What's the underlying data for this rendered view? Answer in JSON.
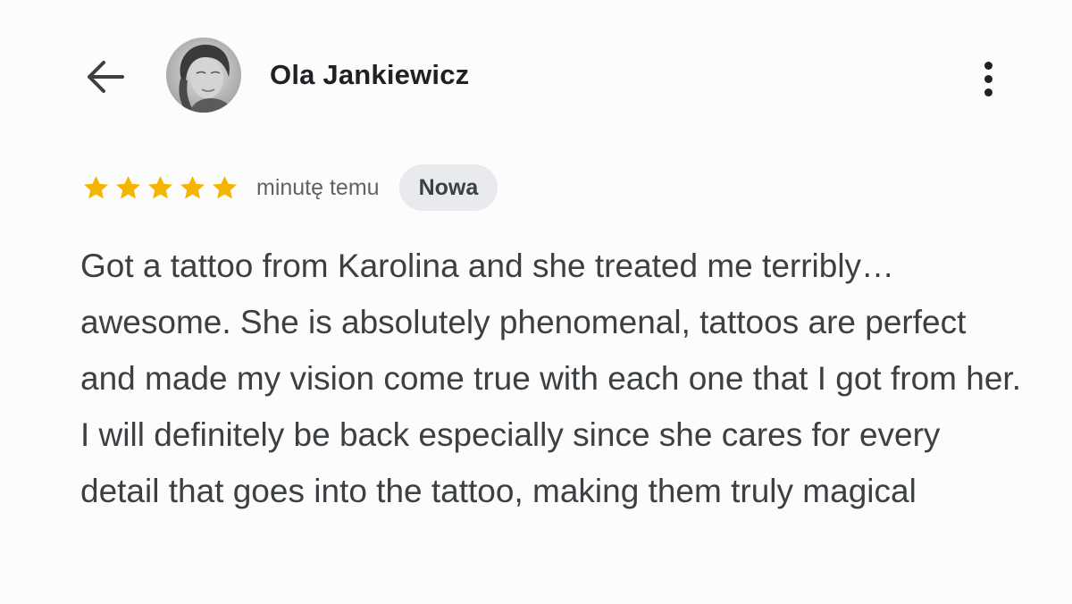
{
  "header": {
    "back_icon": "arrow-left-icon",
    "author_name": "Ola Jankiewicz",
    "avatar": "profile-photo",
    "menu_icon": "more-vertical-icon"
  },
  "review": {
    "rating": 5,
    "rating_max": 5,
    "star_color": "#f4b400",
    "time": "minutę temu",
    "badge": "Nowa",
    "text": "Got a tattoo from Karolina and she treated me terribly… awesome. She is absolutely phenomenal, tattoos are perfect and made my vision come true with each one that I got from her. I will definitely be back especially since she cares for every detail that goes into the tattoo, making them truly magical"
  }
}
